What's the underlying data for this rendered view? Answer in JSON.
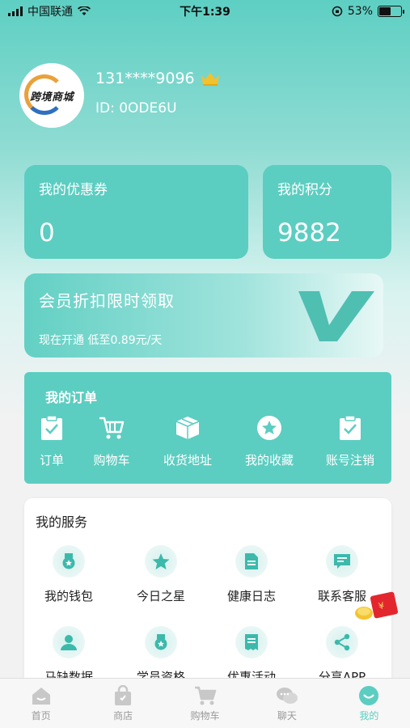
{
  "status_bar": {
    "carrier": "中国联通",
    "time": "下午1:39",
    "battery": "53%",
    "battery_level": 0.53
  },
  "profile": {
    "avatar_logo_text": "跨境商城",
    "phone": "131****9096",
    "user_id": "ID: 0ODE6U"
  },
  "cards": {
    "coupons": {
      "title": "我的优惠券",
      "value": "0"
    },
    "points": {
      "title": "我的积分",
      "value": "9882"
    }
  },
  "vip": {
    "title": "会员折扣限时领取",
    "subtitle": "现在开通 低至0.89元/天"
  },
  "orders": {
    "title": "我的订单",
    "items": [
      {
        "label": "订单",
        "icon": "clipboard-check-icon"
      },
      {
        "label": "购物车",
        "icon": "cart-icon"
      },
      {
        "label": "收货地址",
        "icon": "box-icon"
      },
      {
        "label": "我的收藏",
        "icon": "star-icon"
      },
      {
        "label": "账号注销",
        "icon": "clipboard-check-icon"
      }
    ]
  },
  "services": {
    "title": "我的服务",
    "items": [
      {
        "label": "我的钱包",
        "icon": "medal-icon"
      },
      {
        "label": "今日之星",
        "icon": "star-icon"
      },
      {
        "label": "健康日志",
        "icon": "document-icon"
      },
      {
        "label": "联系客服",
        "icon": "message-icon"
      },
      {
        "label": "马缺数据",
        "icon": "user-icon"
      },
      {
        "label": "学员资格",
        "icon": "medal-icon"
      },
      {
        "label": "优惠活动",
        "icon": "receipt-icon"
      },
      {
        "label": "分享APP",
        "icon": "share-icon"
      }
    ]
  },
  "tabbar": {
    "items": [
      {
        "label": "首页",
        "icon": "home-icon"
      },
      {
        "label": "商店",
        "icon": "bag-icon"
      },
      {
        "label": "购物车",
        "icon": "cart-icon"
      },
      {
        "label": "聊天",
        "icon": "chat-icon"
      },
      {
        "label": "我的",
        "icon": "profile-smile-icon"
      }
    ],
    "active_index": 4
  },
  "colors": {
    "accent": "#5ccdc1",
    "tab_inactive": "#999999",
    "crown": "#f2c12e"
  }
}
